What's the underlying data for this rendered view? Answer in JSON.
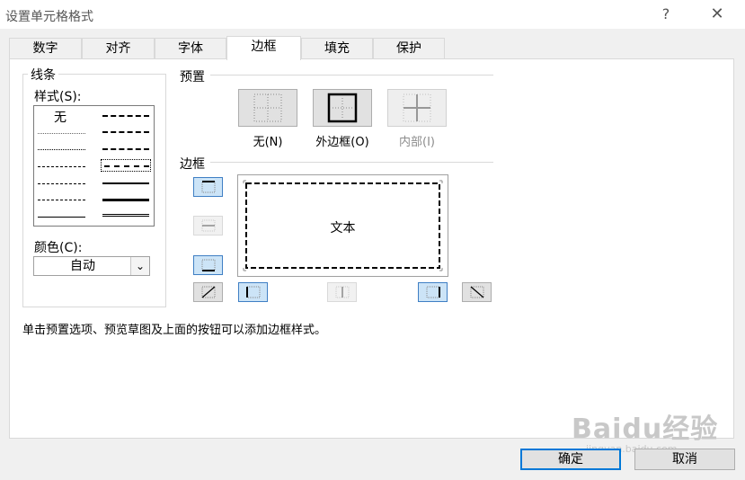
{
  "window": {
    "title": "设置单元格格式",
    "help_glyph": "?",
    "close_glyph": "✕"
  },
  "tabs": [
    {
      "label": "数字",
      "active": false
    },
    {
      "label": "对齐",
      "active": false
    },
    {
      "label": "字体",
      "active": false
    },
    {
      "label": "边框",
      "active": true
    },
    {
      "label": "填充",
      "active": false
    },
    {
      "label": "保护",
      "active": false
    }
  ],
  "line": {
    "group_label": "线条",
    "style_label": "样式(S):",
    "none_label": "无",
    "selected_style": "medium-dashed",
    "color_label": "颜色(C):",
    "color_value": "自动",
    "dropdown_glyph": "⌄"
  },
  "presets": {
    "group_label": "预置",
    "none_label": "无(N)",
    "outline_label": "外边框(O)",
    "inside_label": "内部(I)",
    "inside_disabled": true
  },
  "border": {
    "group_label": "边框",
    "preview_text": "文本",
    "active_borders": [
      "top",
      "bottom",
      "left",
      "right"
    ]
  },
  "hint_text": "单击预置选项、预览草图及上面的按钮可以添加边框样式。",
  "buttons": {
    "ok": "确定",
    "cancel": "取消"
  },
  "watermark": {
    "brand": "Baidu经验",
    "url": "jingyan.baidu.com"
  },
  "colors": {
    "accent": "#0078d7",
    "toggle_on": "#cce4f7"
  }
}
